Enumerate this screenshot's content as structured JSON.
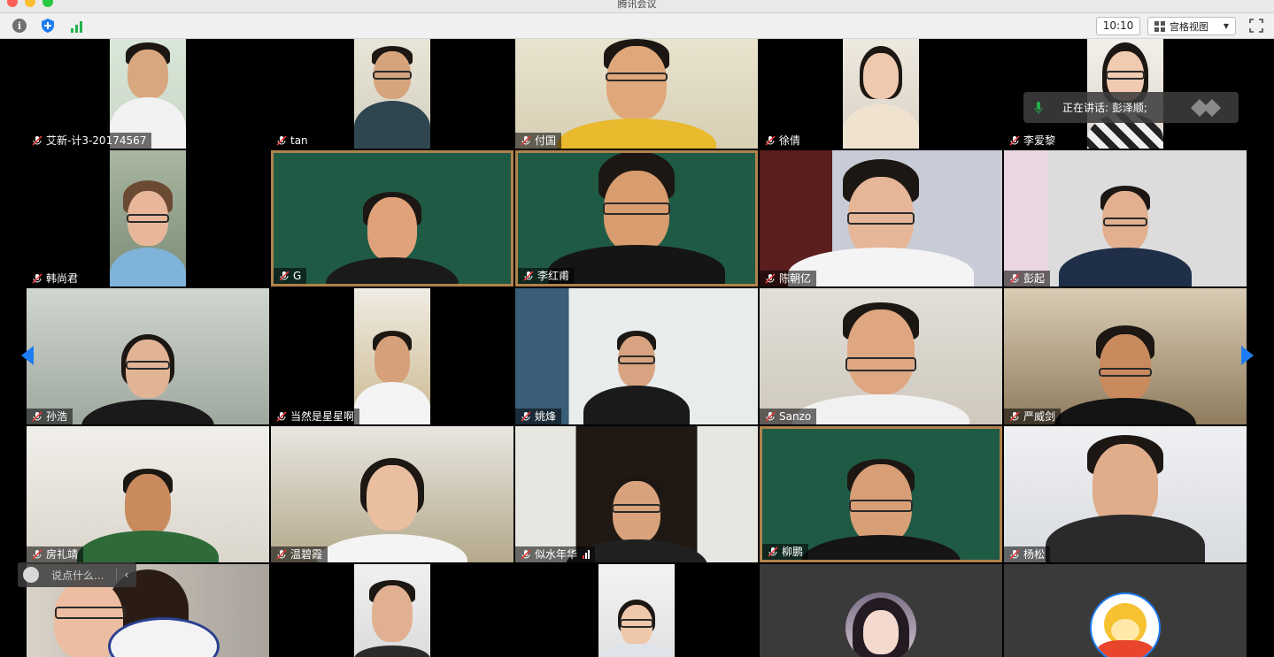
{
  "window": {
    "title": "腾讯会议"
  },
  "toolbar": {
    "info_icon": "info-icon",
    "shield_icon": "shield-icon",
    "signal_icon": "signal-icon",
    "time": "10:10",
    "view_mode": "宫格视图",
    "fullscreen_icon": "fullscreen-icon"
  },
  "speaking": {
    "label": "正在讲话: 彭泽顺;"
  },
  "chat": {
    "placeholder": "说点什么..."
  },
  "participants": [
    {
      "name": "艾新-计3-20174567"
    },
    {
      "name": "tan"
    },
    {
      "name": "付国"
    },
    {
      "name": "徐倩"
    },
    {
      "name": "李爱黎"
    },
    {
      "name": "韩尚君"
    },
    {
      "name": "G"
    },
    {
      "name": "李红甫"
    },
    {
      "name": "陈朝亿"
    },
    {
      "name": "彭起"
    },
    {
      "name": "孙浩"
    },
    {
      "name": "当然是星星啊"
    },
    {
      "name": "姚烽"
    },
    {
      "name": "Sanzo"
    },
    {
      "name": "严威剑"
    },
    {
      "name": "房礼靖"
    },
    {
      "name": "温碧霞"
    },
    {
      "name": "似水年华"
    },
    {
      "name": "柳鹏"
    },
    {
      "name": "杨松"
    }
  ],
  "colors": {
    "accent_blue": "#1e7cf2",
    "mic_green": "#22b14c",
    "muted_red": "#e23b3b"
  }
}
